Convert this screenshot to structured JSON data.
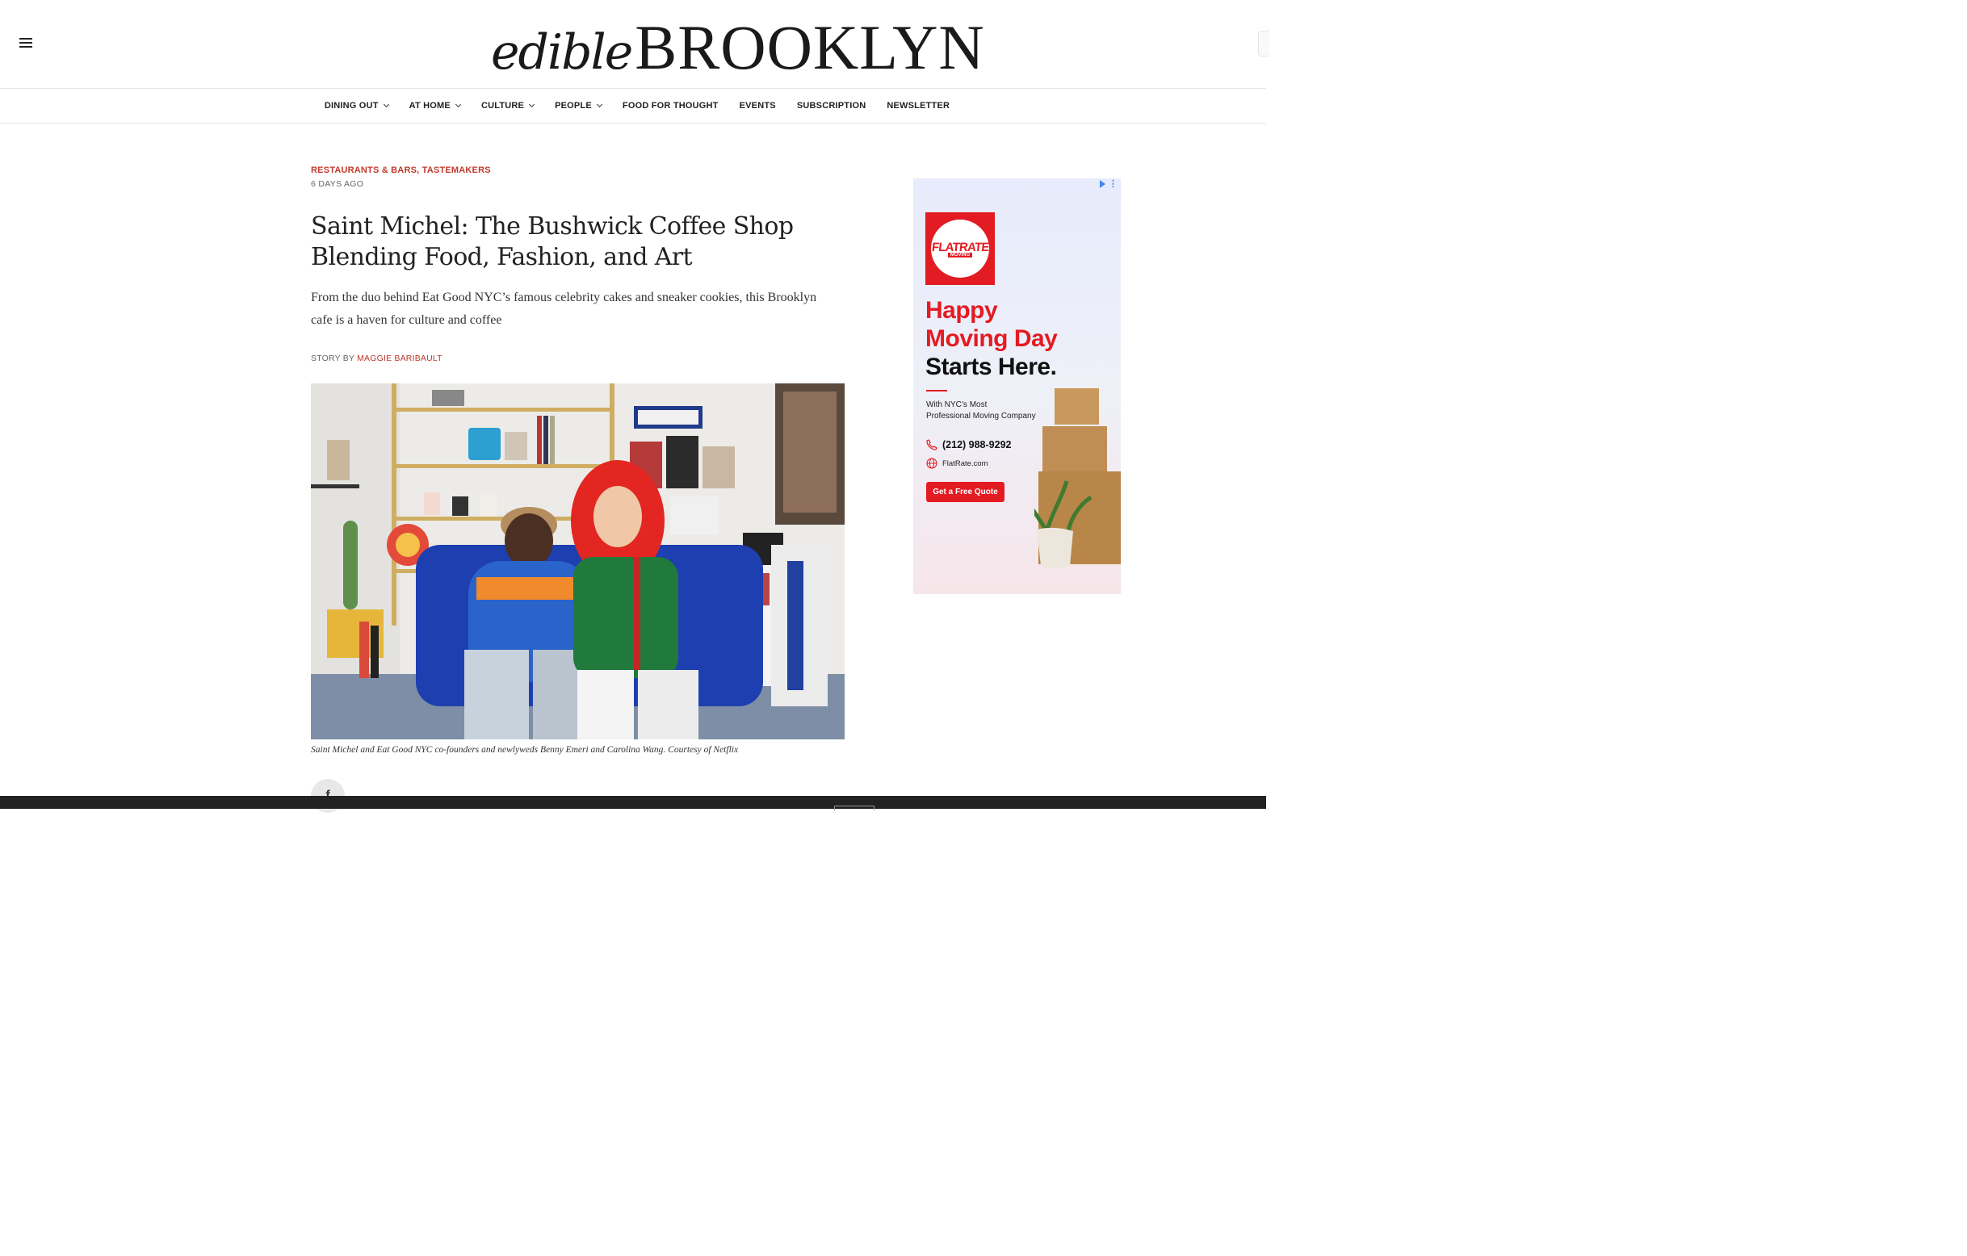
{
  "header": {
    "logo_edible": "edible",
    "logo_brooklyn": "BROOKLYN",
    "menu_icon": "hamburger-icon"
  },
  "nav": {
    "items": [
      {
        "label": "DINING OUT",
        "dropdown": true
      },
      {
        "label": "AT HOME",
        "dropdown": true
      },
      {
        "label": "CULTURE",
        "dropdown": true
      },
      {
        "label": "PEOPLE",
        "dropdown": true
      },
      {
        "label": "FOOD FOR THOUGHT",
        "dropdown": false
      },
      {
        "label": "EVENTS",
        "dropdown": false
      },
      {
        "label": "SUBSCRIPTION",
        "dropdown": false
      },
      {
        "label": "NEWSLETTER",
        "dropdown": false
      }
    ]
  },
  "article": {
    "categories": [
      "RESTAURANTS & BARS",
      "TASTEMAKERS"
    ],
    "category_separator": ", ",
    "date": "6 DAYS AGO",
    "title_line1": "Saint Michel: The Bushwick Coffee Shop",
    "title_line2": "Blending Food, Fashion, and Art",
    "dek_line1": "From the duo behind Eat Good NYC’s famous celebrity cakes and sneaker cookies, this Brooklyn",
    "dek_line2": "cafe is a haven for culture and coffee",
    "byline_prefix": "STORY BY",
    "author": "MAGGIE BARIBAULT",
    "caption": "Saint Michel and Eat Good NYC co-founders and newlyweds Benny Emeri and Carolina Wang. Courtesy of Netflix",
    "share_fb_glyph": "f"
  },
  "ad": {
    "brand": "FLATRATE",
    "brand_sub": "MOVING",
    "headline_red_1": "Happy",
    "headline_red_2": "Moving Day",
    "headline_black": "Starts Here.",
    "sub_line1": "With NYC’s Most",
    "sub_line2": "Professional Moving Company",
    "phone": "(212) 988-9292",
    "website": "FlatRate.com",
    "cta": "Get a Free Quote",
    "colors": {
      "brand_red": "#e31b23",
      "choices_blue": "#4285f4"
    }
  },
  "colors": {
    "accent": "#c0392b",
    "text": "#222222",
    "footer": "#222222"
  }
}
